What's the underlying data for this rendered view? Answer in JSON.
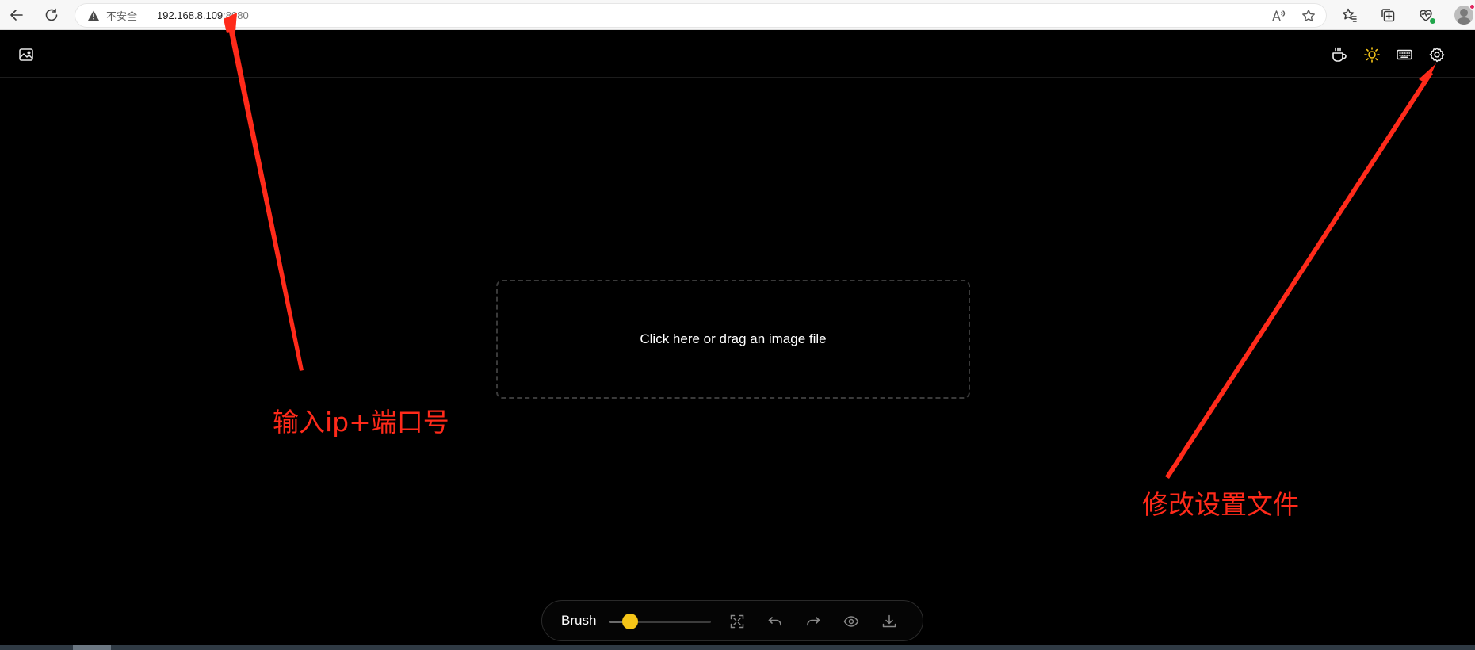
{
  "browser": {
    "security_warning": "不安全",
    "url_host": "192.168.8.109",
    "url_port": ":8080",
    "icons": [
      "back-arrow-icon",
      "reload-icon",
      "warning-triangle-icon",
      "read-aloud-icon",
      "favorite-star-icon",
      "favorites-icon",
      "collections-icon",
      "browser-essentials-icon",
      "profile-icon"
    ]
  },
  "header": {
    "left_icons": [
      "image-icon"
    ],
    "right_icons": [
      "coffee-icon",
      "sun-icon",
      "keyboard-icon",
      "gear-icon"
    ],
    "sun_color": "#f5c518"
  },
  "dropzone": {
    "text": "Click here or drag an image file"
  },
  "annotations": {
    "ip_port": "输入ip+端口号",
    "settings": "修改设置文件",
    "color": "#ff2a1a"
  },
  "toolbar": {
    "brush_label": "Brush",
    "brush_slider_fraction": 0.2,
    "accent_color": "#f5c518",
    "icons": [
      "fit-screen-icon",
      "undo-icon",
      "redo-icon",
      "eye-icon",
      "download-icon"
    ]
  }
}
